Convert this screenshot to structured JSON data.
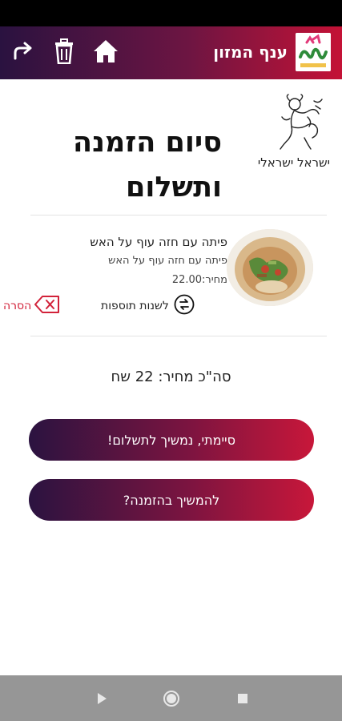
{
  "app_bar": {
    "title": "ענף המזון",
    "logo": "sheffa-logo",
    "home_icon": "home-icon",
    "trash_icon": "trash-icon",
    "share_icon": "share-forward-icon"
  },
  "brand": {
    "name": "ישראל ישראלי"
  },
  "heading": "סיום הזמנה ותשלום",
  "order_item": {
    "name": "פיתה עם חזה עוף על האש",
    "description": "פיתה עם חזה עוף על האש",
    "price": "מחיר:22.00",
    "change_extras": "לשנות תוספות",
    "remove": "הסרה"
  },
  "total": "סה\"כ מחיר: 22 שח",
  "buttons": {
    "finish": "סיימתי, נמשיך לתשלום!",
    "continue": "להמשיך בהזמנה?"
  },
  "colors": {
    "accent_dark": "#2b1340",
    "accent_red": "#c8173a",
    "remove_red": "#d2223a"
  }
}
